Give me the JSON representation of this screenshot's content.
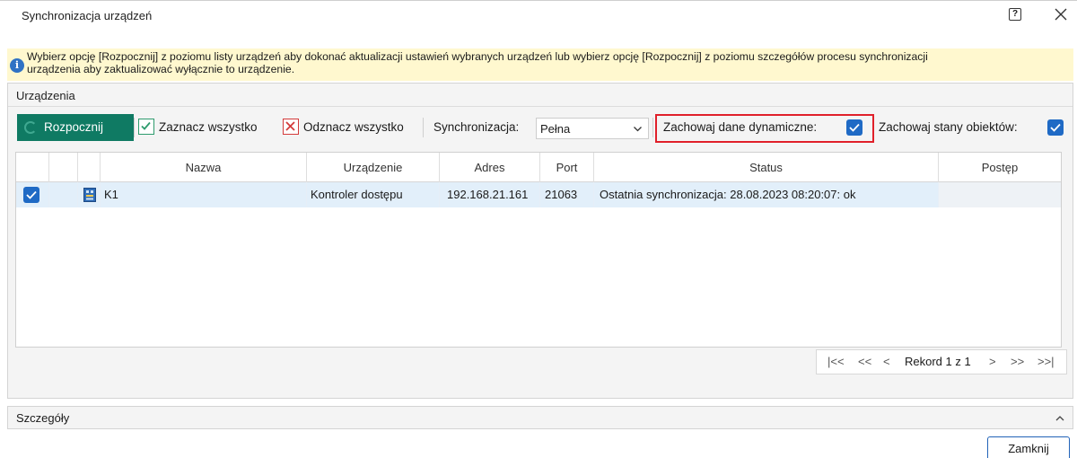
{
  "window": {
    "title": "Synchronizacja urządzeń",
    "help_glyph": "?",
    "close_glyph": "✕"
  },
  "info": {
    "icon": "info-icon",
    "line1": "Wybierz opcję [Rozpocznij] z poziomu listy urządzeń aby dokonać aktualizacji ustawień wybranych urządzeń lub wybierz opcję [Rozpocznij] z poziomu szczegółów procesu synchronizacji",
    "line2": "urządzenia aby zaktualizować wyłącznie to urządzenie."
  },
  "devices_panel": {
    "title": "Urządzenia",
    "toolbar": {
      "start_label": "Rozpocznij",
      "select_all_label": "Zaznacz wszystko",
      "deselect_all_label": "Odznacz wszystko",
      "sync_label": "Synchronizacja:",
      "sync_value": "Pełna",
      "keep_dynamic_label": "Zachowaj dane dynamiczne:",
      "keep_dynamic_checked": true,
      "keep_states_label": "Zachowaj stany obiektów:",
      "keep_states_checked": true
    },
    "columns": [
      "Nazwa",
      "Urządzenie",
      "Adres",
      "Port",
      "Status",
      "Postęp"
    ],
    "rows": [
      {
        "checked": true,
        "icon": "controller-icon",
        "name": "K1",
        "device": "Kontroler dostępu",
        "address": "192.168.21.161",
        "port": "21063",
        "status": "Ostatnia synchronizacja: 28.08.2023 08:20:07: ok",
        "progress": ""
      }
    ],
    "pager": {
      "first": "|<<",
      "prev_page": "<<",
      "prev": "<",
      "record_text": "Rekord 1 z 1",
      "next": ">",
      "next_page": ">>",
      "last": ">>|"
    }
  },
  "details": {
    "title": "Szczegóły",
    "caret": "^"
  },
  "footer": {
    "close_label": "Zamknij"
  },
  "colors": {
    "accent_green": "#0f7a63",
    "check_blue": "#1f6ac5",
    "highlight_red": "#e0202a",
    "info_bg": "#fff8cf",
    "selected_row": "#e2effa"
  }
}
